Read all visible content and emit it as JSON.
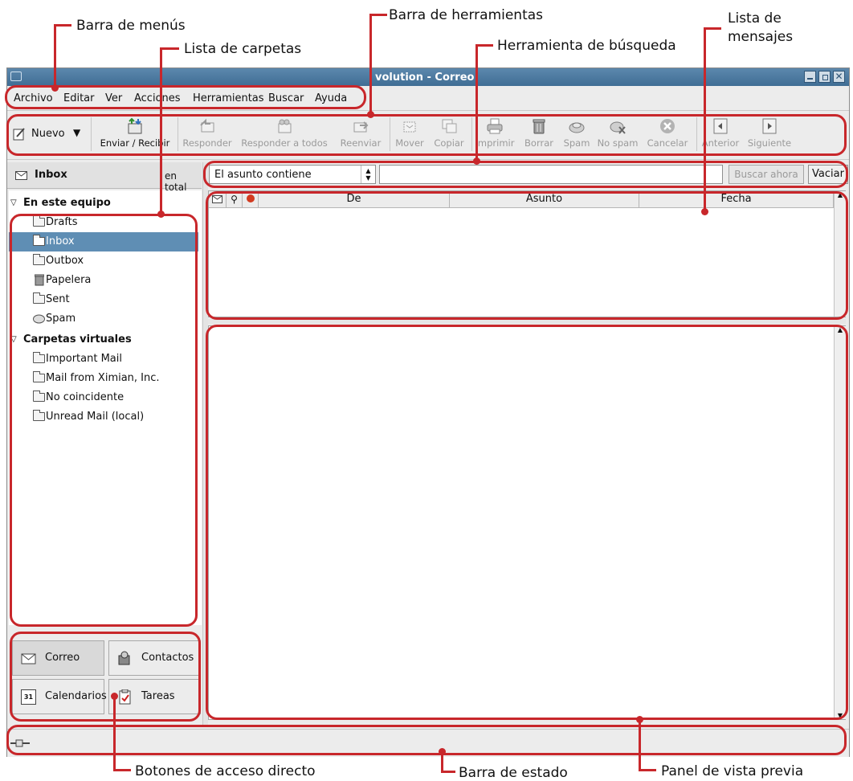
{
  "annotations": {
    "menu_bar": "Barra de menús",
    "folder_list": "Lista de carpetas",
    "toolbar": "Barra de herramientas",
    "search_tool": "Herramienta de búsqueda",
    "message_list_1": "Lista de",
    "message_list_2": "mensajes",
    "shortcut_buttons": "Botones de acceso directo",
    "status_bar": "Barra de estado",
    "preview_pane": "Panel de vista previa"
  },
  "window": {
    "title": "volution - Correo"
  },
  "menu": [
    "Archivo",
    "Editar",
    "Ver",
    "Acciones",
    "Herramientas",
    "Buscar",
    "Ayuda"
  ],
  "toolbar": {
    "new": "Nuevo",
    "send_receive": "Enviar / Recibir",
    "reply": "Responder",
    "reply_all": "Responder a todos",
    "forward": "Reenviar",
    "move": "Mover",
    "copy": "Copiar",
    "print": "Imprimir",
    "delete": "Borrar",
    "spam": "Spam",
    "not_spam": "No spam",
    "cancel": "Cancelar",
    "previous": "Anterior",
    "next": "Siguiente"
  },
  "sidebar": {
    "header_title": "Inbox",
    "header_count": "en total",
    "group_local": "En este equipo",
    "local_folders": [
      "Drafts",
      "Inbox",
      "Outbox",
      "Papelera",
      "Sent",
      "Spam"
    ],
    "selected": "Inbox",
    "group_virtual": "Carpetas virtuales",
    "virtual_folders": [
      "Important Mail",
      "Mail from Ximian, Inc.",
      "No coincidente",
      "Unread Mail (local)"
    ]
  },
  "search": {
    "condition": "El asunto contiene",
    "value": "",
    "find_now": "Buscar ahora",
    "clear": "Vaciar"
  },
  "message_list": {
    "columns": [
      "De",
      "Asunto",
      "Fecha"
    ]
  },
  "shortcuts": [
    "Correo",
    "Contactos",
    "Calendarios",
    "Tareas"
  ],
  "calendar_icon_day": "31"
}
